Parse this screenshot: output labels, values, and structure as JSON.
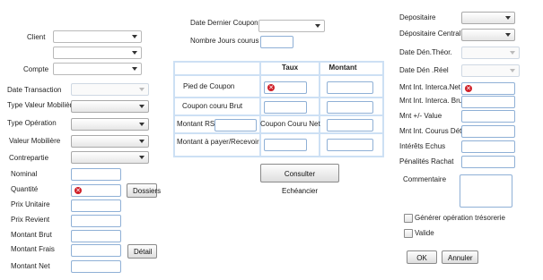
{
  "left": {
    "client_label": "Client",
    "compte_label": "Compte",
    "date_transaction_label": "Date Transaction",
    "type_valeur_label": "Type Valeur Mobilière",
    "type_operation_label": "Type Opération",
    "valeur_mobiliere_label": "Valeur Mobilière",
    "contrepartie_label": "Contrepartie",
    "nominal_label": "Nominal",
    "quantite_label": "Quantité",
    "prix_unitaire_label": "Prix Unitaire",
    "prix_revient_label": "Prix Revient",
    "montant_brut_label": "Montant Brut",
    "montant_frais_label": "Montant Frais",
    "montant_net_label": "Montant Net",
    "dossiers_button": "Dossiers",
    "detail_button": "Détail"
  },
  "center": {
    "date_dernier_coupon_label": "Date Dernier Coupon",
    "nombre_jours_label": "Nombre Jours courus",
    "col_taux": "Taux",
    "col_montant": "Montant",
    "pied_coupon_label": "Pied de Coupon",
    "coupon_couru_brut_label": "Coupon couru Brut",
    "montant_rs_label": "Montant RS",
    "coupon_couru_net_label": "Coupon Couru Net",
    "montant_payer_label": "Montant à payer/Recevoir",
    "consulter_button": "Consulter  Echéancier"
  },
  "right": {
    "depositaire_label": "Depositaire",
    "depositaire_central_label": "Dépositaire Central",
    "date_den_theor_label": "Date Dén.Théor.",
    "date_den_reel_label": "Date Dén .Réel",
    "mnt_int_interca_net_label": "Mnt Int. Interca.Net",
    "mnt_int_interca_brut_label": "Mnt Int. Interca. Brut",
    "mnt_value_label": "Mnt +/- Value",
    "mnt_int_courus_label": "Mnt Int. Courus Dét.",
    "interets_echus_label": "Intérêts Echus",
    "penalites_rachat_label": "Pénalités Rachat",
    "commentaire_label": "Commentaire",
    "generer_label": "Générer opération trésorerie",
    "valide_label": "Valide",
    "ok_button": "OK",
    "annuler_button": "Annuler"
  },
  "icons": {
    "error": "error-icon",
    "dropdown": "chevron-down-icon"
  },
  "colors": {
    "field_border": "#8fb0d6",
    "grid_line": "#cde0f4",
    "error_red": "#cf1f28"
  }
}
